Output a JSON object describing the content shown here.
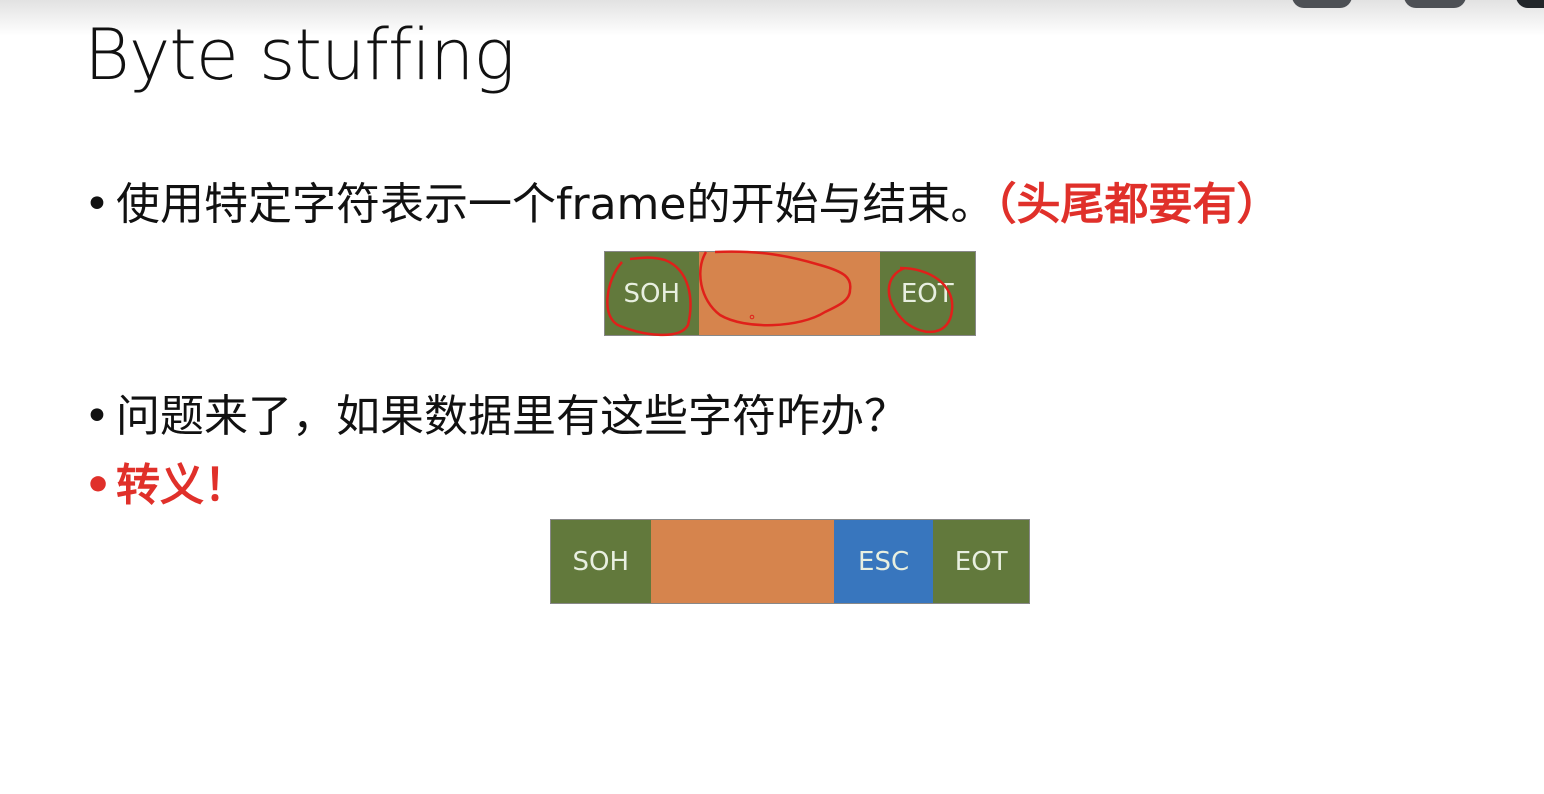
{
  "slide": {
    "title": "Byte stuffing",
    "bullets": [
      {
        "marker": "•",
        "text": "使用特定字符表示一个frame的开始与结束。",
        "emphasis": "（头尾都要有）"
      },
      {
        "marker": "•",
        "text": "问题来了，如果数据里有这些字符咋办？"
      },
      {
        "marker": "•",
        "text": "转义！"
      }
    ],
    "frame1": {
      "start": "SOH",
      "payload": "",
      "end": "EOT"
    },
    "frame2": {
      "start": "SOH",
      "payload": "",
      "escape": "ESC",
      "end": "EOT"
    }
  },
  "colors": {
    "flag": "#62793c",
    "payload": "#d6844d",
    "escape": "#3876be",
    "emphasis": "#e0302a",
    "annotation": "#e0201a"
  }
}
